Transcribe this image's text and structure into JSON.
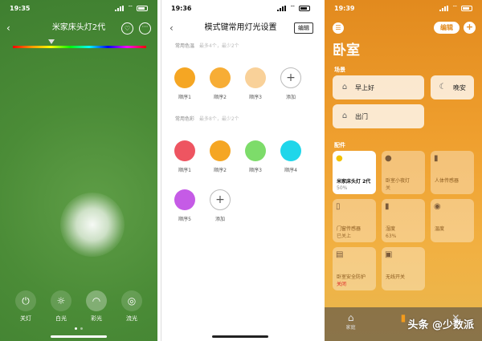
{
  "phone1": {
    "status": {
      "time": "19:35"
    },
    "title": "米家床头灯2代",
    "modes": [
      {
        "label": "关灯",
        "icon": "power-icon",
        "glyph": "⏻"
      },
      {
        "label": "白光",
        "icon": "sun-icon",
        "glyph": "☼"
      },
      {
        "label": "彩光",
        "icon": "rainbow-icon",
        "glyph": "◠"
      },
      {
        "label": "流光",
        "icon": "flow-icon",
        "glyph": "◎"
      }
    ],
    "active_mode_index": 2,
    "page_dots": 2,
    "active_page": 0
  },
  "phone2": {
    "status": {
      "time": "19:36"
    },
    "title": "模式键常用灯光设置",
    "edit": "编辑",
    "section1": {
      "title": "常用色温",
      "hint": "最多4个，最少2个"
    },
    "section2": {
      "title": "常用色彩",
      "hint": "最多8个，最少2个"
    },
    "temps": [
      {
        "label": "顺序1",
        "color": "#f5a623"
      },
      {
        "label": "顺序2",
        "color": "#f7ad35"
      },
      {
        "label": "顺序3",
        "color": "#f9d199"
      },
      {
        "label": "添加",
        "add": true
      }
    ],
    "colors_row1": [
      {
        "label": "顺序1",
        "color": "#ee5561"
      },
      {
        "label": "顺序2",
        "color": "#f5a623"
      },
      {
        "label": "顺序3",
        "color": "#7ddc6a"
      },
      {
        "label": "顺序4",
        "color": "#1fd6ea"
      }
    ],
    "colors_row2": [
      {
        "label": "顺序5",
        "color": "#c55be6"
      },
      {
        "label": "添加",
        "add": true
      }
    ]
  },
  "phone3": {
    "status": {
      "time": "19:39"
    },
    "edit": "编辑",
    "room": "卧室",
    "scenes_label": "场景",
    "scenes": [
      {
        "name": "早上好",
        "icon": "morning-home-icon",
        "glyph": "⌂"
      },
      {
        "name": "晚安",
        "icon": "night-home-icon",
        "glyph": "☾"
      },
      {
        "name": "出门",
        "icon": "leave-home-icon",
        "glyph": "⌂"
      }
    ],
    "accessories_label": "配件",
    "accessories": [
      {
        "name": "米家床头灯 2代",
        "status": "50%",
        "on": true,
        "icon": "bulb-icon",
        "glyph": "●"
      },
      {
        "name": "卧室小夜灯",
        "status": "关",
        "on": false,
        "icon": "bulb-icon",
        "glyph": "●"
      },
      {
        "name": "人体传感器",
        "status": "",
        "on": false,
        "icon": "sensor-icon",
        "glyph": "▮"
      },
      {
        "name": "门窗传感器",
        "status": "已关上",
        "on": false,
        "icon": "door-sensor-icon",
        "glyph": "▯"
      },
      {
        "name": "湿度",
        "status": "63%",
        "on": false,
        "icon": "humidity-icon",
        "glyph": "▮"
      },
      {
        "name": "温度",
        "status": "",
        "on": false,
        "icon": "thermometer-icon",
        "glyph": "◉"
      },
      {
        "name": "卧室安全防护",
        "status": "关闭",
        "status_red": true,
        "on": false,
        "icon": "security-icon",
        "glyph": "▤"
      },
      {
        "name": "无线开关",
        "status": "",
        "on": false,
        "icon": "switch-icon",
        "glyph": "▣"
      }
    ],
    "tabs": [
      {
        "label": "家庭",
        "glyph": "⌂"
      },
      {
        "label": "",
        "glyph": "▮"
      },
      {
        "label": "",
        "glyph": "✕"
      }
    ],
    "active_tab": 1,
    "watermark": "头条 @少数派"
  }
}
